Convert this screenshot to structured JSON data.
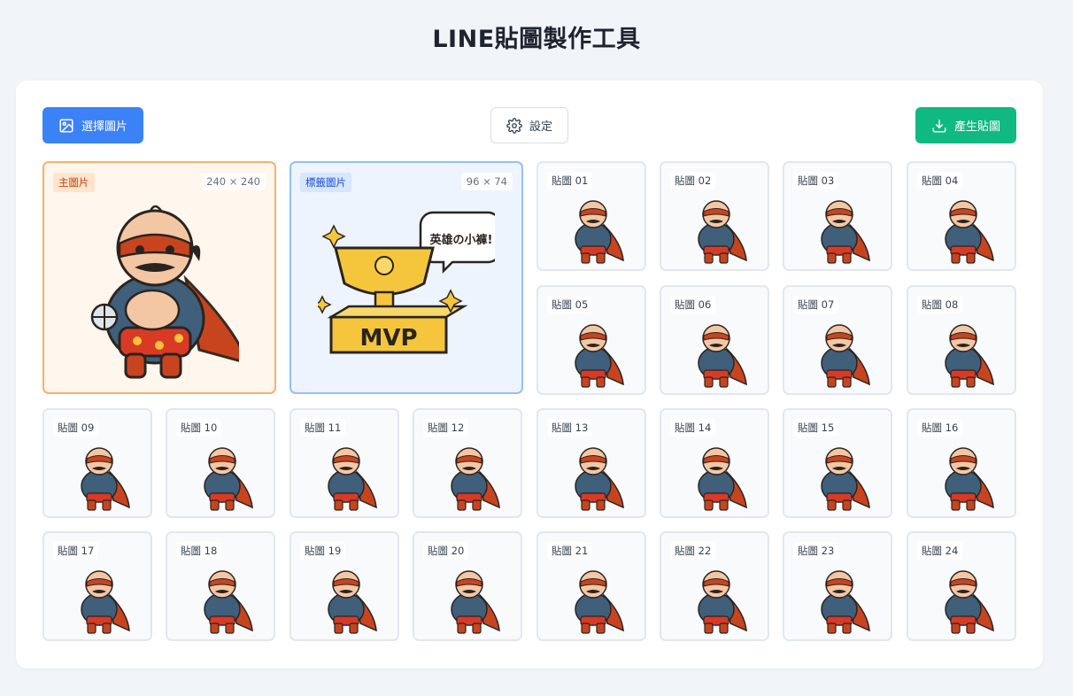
{
  "page": {
    "title": "LINE貼圖製作工具"
  },
  "toolbar": {
    "select_label": "選擇圖片",
    "settings_label": "設定",
    "generate_label": "產生貼圖"
  },
  "main_image": {
    "tag": "主圖片",
    "dims": "240 × 240"
  },
  "tab_image": {
    "tag": "標籤圖片",
    "dims": "96 × 74",
    "speech": "英雄の小褲!",
    "trophy_text": "MVP"
  },
  "stickers": [
    {
      "label": "貼圖 01"
    },
    {
      "label": "貼圖 02"
    },
    {
      "label": "貼圖 03"
    },
    {
      "label": "貼圖 04"
    },
    {
      "label": "貼圖 05"
    },
    {
      "label": "貼圖 06"
    },
    {
      "label": "貼圖 07"
    },
    {
      "label": "貼圖 08"
    },
    {
      "label": "貼圖 09"
    },
    {
      "label": "貼圖 10"
    },
    {
      "label": "貼圖 11"
    },
    {
      "label": "貼圖 12"
    },
    {
      "label": "貼圖 13"
    },
    {
      "label": "貼圖 14"
    },
    {
      "label": "貼圖 15"
    },
    {
      "label": "貼圖 16"
    },
    {
      "label": "貼圖 17"
    },
    {
      "label": "貼圖 18"
    },
    {
      "label": "貼圖 19"
    },
    {
      "label": "貼圖 20"
    },
    {
      "label": "貼圖 21"
    },
    {
      "label": "貼圖 22"
    },
    {
      "label": "貼圖 23"
    },
    {
      "label": "貼圖 24"
    }
  ],
  "colors": {
    "primary": "#3b82f6",
    "success": "#10b981",
    "main_border": "#fbb06a",
    "tab_border": "#93c1f3"
  }
}
